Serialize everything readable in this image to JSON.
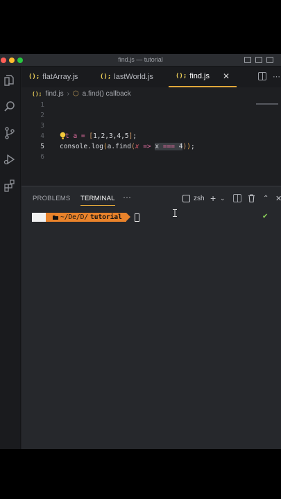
{
  "window": {
    "title": "find.js — tutorial"
  },
  "tabs": [
    {
      "label": "flatArray.js",
      "icon": "{}",
      "active": false
    },
    {
      "label": "lastWorld.js",
      "icon": "{}",
      "active": false
    },
    {
      "label": "find.js",
      "icon": "{}",
      "active": true
    }
  ],
  "tab_icon_text": "();",
  "breadcrumb": {
    "file": "find.js",
    "symbol": "a.find() callback"
  },
  "editor": {
    "lines": [
      {
        "n": "1"
      },
      {
        "n": "2"
      },
      {
        "n": "3"
      },
      {
        "n": "4",
        "t1": "t a = ",
        "t2": "[",
        "t3": "1,2,3,4,5",
        "t4": "]",
        "t5": ";"
      },
      {
        "n": "5",
        "t1": "console.log",
        "t2": "(",
        "t3": "a.find",
        "t4": "(",
        "t5": "x",
        "t6": "=>",
        "t7": "x",
        "t8": "===",
        "t9": "4",
        "t10": ")",
        "t11": ")",
        "t12": ";"
      },
      {
        "n": "6"
      }
    ],
    "minimap_text": "console.log(...)"
  },
  "panel": {
    "tabs": [
      "PROBLEMS",
      "TERMINAL"
    ],
    "active_tab": "TERMINAL",
    "more": "···",
    "shell": "zsh",
    "add": "+"
  },
  "terminal": {
    "apple": "",
    "folder_icon": "folder-icon",
    "path_prefix": "~/De/D/",
    "path_bold": "tutorial",
    "status": "✔"
  },
  "colors": {
    "accent": "#e0a73a",
    "prompt_segment": "#e9832b",
    "keyword": "#e06c9f",
    "param": "#e35d6a"
  }
}
